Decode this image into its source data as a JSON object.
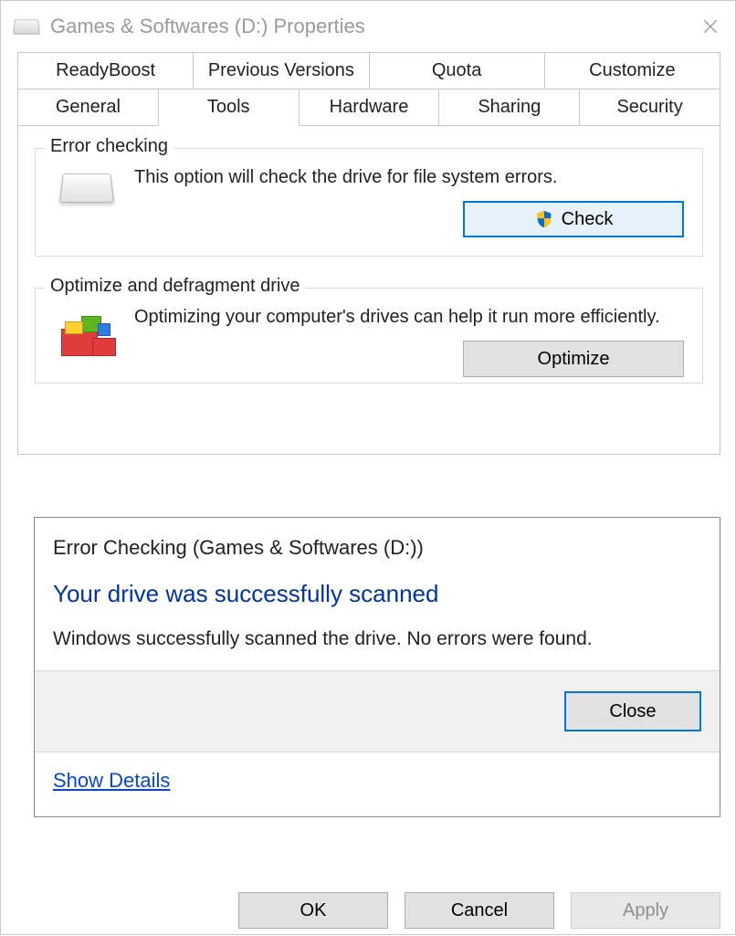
{
  "titlebar": {
    "title": "Games & Softwares (D:) Properties"
  },
  "tabs": {
    "row1": [
      "ReadyBoost",
      "Previous Versions",
      "Quota",
      "Customize"
    ],
    "row2": [
      "General",
      "Tools",
      "Hardware",
      "Sharing",
      "Security"
    ],
    "active": "Tools"
  },
  "error_check_group": {
    "title": "Error checking",
    "description": "This option will check the drive for file system errors.",
    "button": "Check"
  },
  "optimize_group": {
    "title": "Optimize and defragment drive",
    "description": "Optimizing your computer's drives can help it run more efficiently.",
    "button": "Optimize"
  },
  "dialog": {
    "title": "Error Checking (Games & Softwares (D:))",
    "headline": "Your drive was successfully scanned",
    "message": "Windows successfully scanned the drive. No errors were found.",
    "close": "Close",
    "details": "Show Details"
  },
  "footer": {
    "ok": "OK",
    "cancel": "Cancel",
    "apply": "Apply"
  }
}
